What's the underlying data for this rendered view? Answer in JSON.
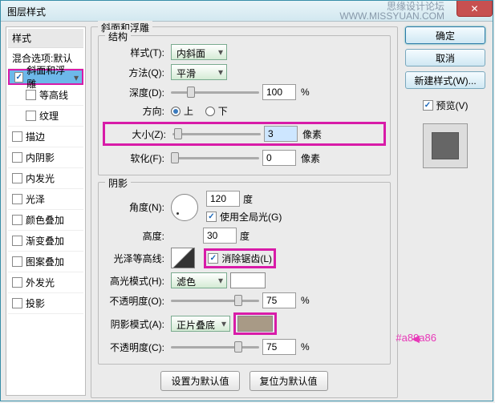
{
  "window": {
    "title": "图层样式"
  },
  "watermark": {
    "l1": "思缘设计论坛",
    "l2": "WWW.MISSYUAN.COM"
  },
  "sidebar": {
    "header": "样式",
    "blend": "混合选项:默认",
    "items": [
      {
        "label": "斜面和浮雕",
        "checked": true,
        "selected": true
      },
      {
        "label": "等高线",
        "checked": false,
        "sub": true
      },
      {
        "label": "纹理",
        "checked": false,
        "sub": true
      },
      {
        "label": "描边",
        "checked": false
      },
      {
        "label": "内阴影",
        "checked": false
      },
      {
        "label": "内发光",
        "checked": false
      },
      {
        "label": "光泽",
        "checked": false
      },
      {
        "label": "颜色叠加",
        "checked": false
      },
      {
        "label": "渐变叠加",
        "checked": false
      },
      {
        "label": "图案叠加",
        "checked": false
      },
      {
        "label": "外发光",
        "checked": false
      },
      {
        "label": "投影",
        "checked": false
      }
    ]
  },
  "bevel": {
    "group": "斜面和浮雕",
    "structure": "结构",
    "style_l": "样式(T):",
    "style_v": "内斜面",
    "method_l": "方法(Q):",
    "method_v": "平滑",
    "depth_l": "深度(D):",
    "depth_v": "100",
    "pct": "%",
    "dir_l": "方向:",
    "up": "上",
    "down": "下",
    "size_l": "大小(Z):",
    "size_v": "3",
    "px": "像素",
    "soft_l": "软化(F):",
    "soft_v": "0",
    "shading": "阴影",
    "angle_l": "角度(N):",
    "angle_v": "120",
    "deg": "度",
    "global": "使用全局光(G)",
    "alt_l": "高度:",
    "alt_v": "30",
    "gloss_l": "光泽等高线:",
    "aa": "消除锯齿(L)",
    "hi_l": "高光模式(H):",
    "hi_v": "滤色",
    "hi_op_l": "不透明度(O):",
    "hi_op_v": "75",
    "sh_l": "阴影模式(A):",
    "sh_v": "正片叠底",
    "sh_op_l": "不透明度(C):",
    "sh_op_v": "75"
  },
  "buttons": {
    "ok": "确定",
    "cancel": "取消",
    "newstyle": "新建样式(W)...",
    "preview": "预览(V)",
    "def": "设置为默认值",
    "reset": "复位为默认值"
  },
  "annot": {
    "color": "#a89a86"
  }
}
